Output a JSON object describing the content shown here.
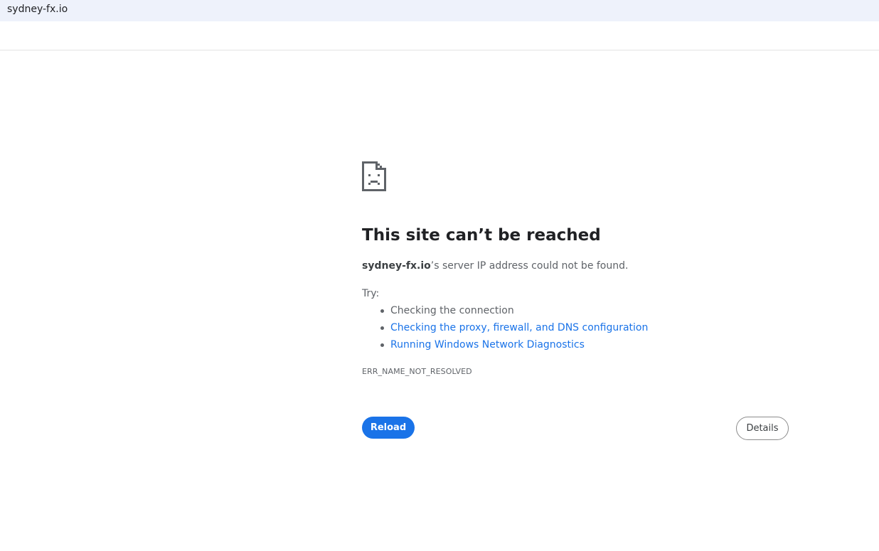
{
  "address_bar": {
    "url": "sydney-fx.io"
  },
  "error": {
    "icon": "sad-page-icon",
    "title": "This site can’t be reached",
    "host": "sydney-fx.io",
    "message_suffix": "’s server IP address could not be found.",
    "try_label": "Try:",
    "suggestions": [
      {
        "text": "Checking the connection",
        "is_link": false
      },
      {
        "text": "Checking the proxy, firewall, and DNS configuration",
        "is_link": true
      },
      {
        "text": "Running Windows Network Diagnostics",
        "is_link": true
      }
    ],
    "code": "ERR_NAME_NOT_RESOLVED"
  },
  "buttons": {
    "reload_label": "Reload",
    "details_label": "Details"
  },
  "colors": {
    "accent": "#1a73e8",
    "address_bar_bg": "#eef2fb",
    "text_secondary": "#5f6368"
  }
}
